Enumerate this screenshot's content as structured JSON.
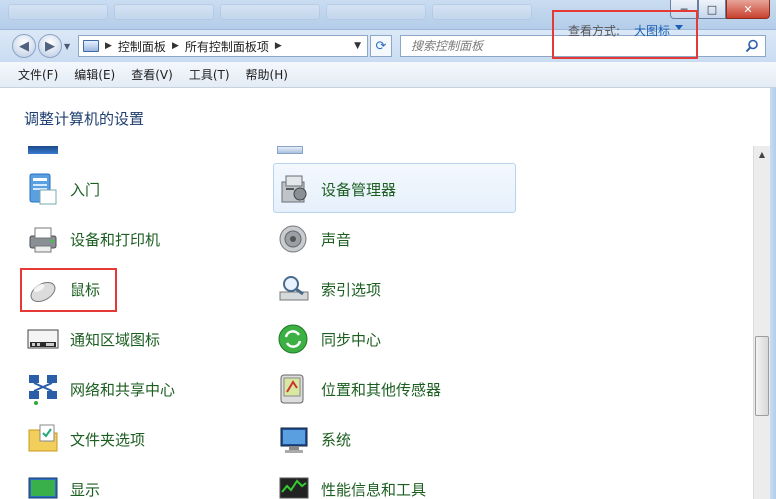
{
  "window": {
    "controls": {
      "minimize": "─",
      "maximize": "□",
      "close": "✕"
    }
  },
  "address_bar": {
    "crumbs": [
      "控制面板",
      "所有控制面板项"
    ],
    "search_placeholder": "搜索控制面板"
  },
  "menu": [
    "文件(F)",
    "编辑(E)",
    "查看(V)",
    "工具(T)",
    "帮助(H)"
  ],
  "header": {
    "title": "调整计算机的设置",
    "view_by_label": "查看方式:",
    "view_by_value": "大图标"
  },
  "items_left": [
    {
      "label": "入门",
      "icon": "getting-started-icon"
    },
    {
      "label": "设备和打印机",
      "icon": "printer-icon"
    },
    {
      "label": "鼠标",
      "icon": "mouse-icon"
    },
    {
      "label": "通知区域图标",
      "icon": "notification-area-icon"
    },
    {
      "label": "网络和共享中心",
      "icon": "network-icon"
    },
    {
      "label": "文件夹选项",
      "icon": "folder-options-icon"
    },
    {
      "label": "显示",
      "icon": "display-icon"
    }
  ],
  "items_right": [
    {
      "label": "设备管理器",
      "icon": "device-manager-icon"
    },
    {
      "label": "声音",
      "icon": "speaker-icon"
    },
    {
      "label": "索引选项",
      "icon": "indexing-icon"
    },
    {
      "label": "同步中心",
      "icon": "sync-icon"
    },
    {
      "label": "位置和其他传感器",
      "icon": "location-sensor-icon"
    },
    {
      "label": "系统",
      "icon": "system-icon"
    },
    {
      "label": "性能信息和工具",
      "icon": "performance-icon"
    }
  ],
  "colors": {
    "highlight_box": "#e53935",
    "link_green": "#1b5e20",
    "link_blue": "#1a5fb4"
  }
}
